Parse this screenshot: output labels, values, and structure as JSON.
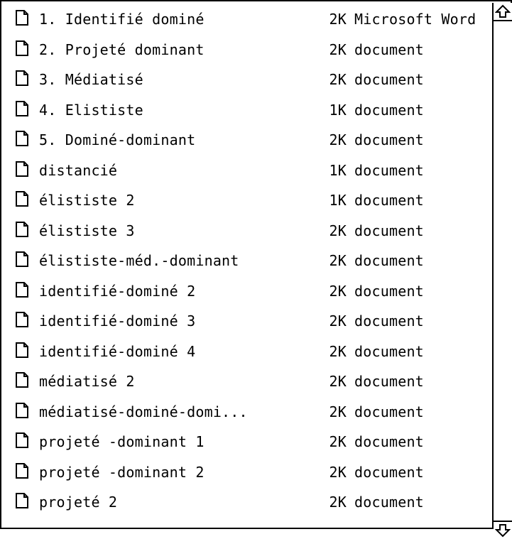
{
  "files": [
    {
      "name": "1. Identifié dominé",
      "size": "2K",
      "kind": "Microsoft Word"
    },
    {
      "name": "2. Projeté dominant",
      "size": "2K",
      "kind": "document"
    },
    {
      "name": "3. Médiatisé",
      "size": "2K",
      "kind": "document"
    },
    {
      "name": "4. Elististe",
      "size": "1K",
      "kind": "document"
    },
    {
      "name": "5. Dominé-dominant",
      "size": "2K",
      "kind": "document"
    },
    {
      "name": "distancié",
      "size": "1K",
      "kind": "document"
    },
    {
      "name": "élististe 2",
      "size": "1K",
      "kind": "document"
    },
    {
      "name": "élististe 3",
      "size": "2K",
      "kind": "document"
    },
    {
      "name": "élististe-méd.-dominant",
      "size": "2K",
      "kind": "document"
    },
    {
      "name": "identifié-dominé 2",
      "size": "2K",
      "kind": "document"
    },
    {
      "name": "identifié-dominé 3",
      "size": "2K",
      "kind": "document"
    },
    {
      "name": "identifié-dominé 4",
      "size": "2K",
      "kind": "document"
    },
    {
      "name": "médiatisé 2",
      "size": "2K",
      "kind": "document"
    },
    {
      "name": "médiatisé-dominé-domi...",
      "size": "2K",
      "kind": "document"
    },
    {
      "name": "projeté -dominant 1",
      "size": "2K",
      "kind": "document"
    },
    {
      "name": "projeté -dominant 2",
      "size": "2K",
      "kind": "document"
    },
    {
      "name": "projeté 2",
      "size": "2K",
      "kind": "document"
    }
  ],
  "icons": {
    "file": "document-icon",
    "scroll_up": "scroll-up-arrow-icon",
    "scroll_down": "scroll-down-arrow-icon"
  }
}
